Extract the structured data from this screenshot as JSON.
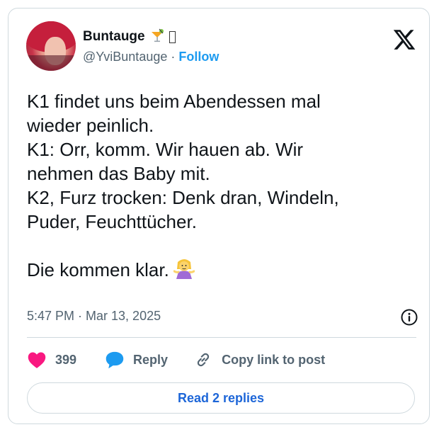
{
  "author": {
    "display_name": "Buntauge",
    "name_emojis": [
      "cocktail-emoji",
      "missing-glyph"
    ],
    "handle": "@YviBuntauge",
    "separator": "·",
    "follow_label": "Follow"
  },
  "tweet": {
    "text": "K1 findet uns beim Abendessen mal\nwieder peinlich.\nK1: Orr, komm. Wir hauen ab. Wir\nnehmen das Baby mit.\nK2, Furz trocken: Denk dran, Windeln,\nPuder, Feuchttücher.\n\nDie kommen klar.",
    "trailing_emoji": "woman-shrugging-emoji",
    "timestamp": "5:47 PM · Mar 13, 2025"
  },
  "actions": {
    "like_count": "399",
    "reply_label": "Reply",
    "copy_link_label": "Copy link to post"
  },
  "footer": {
    "read_replies_label": "Read 2 replies"
  },
  "colors": {
    "accent_blue": "#1d9bf0",
    "like_red": "#f91880",
    "text_primary": "#0f1419",
    "text_secondary": "#536471",
    "border": "#cfd9de"
  }
}
